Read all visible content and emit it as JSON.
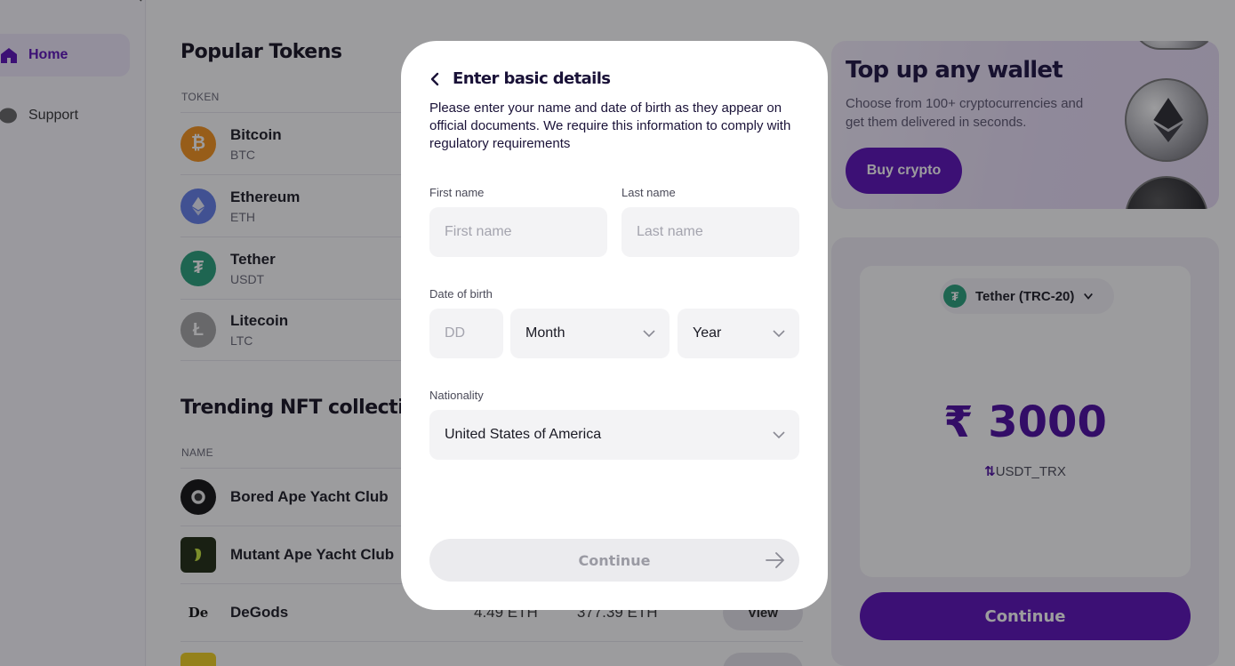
{
  "sidebar": {
    "items": [
      {
        "label": "Home",
        "icon": "home-icon",
        "active": true
      },
      {
        "label": "Support",
        "icon": "chat-icon",
        "active": false
      }
    ]
  },
  "tokens": {
    "title": "Popular Tokens",
    "col_token": "TOKEN",
    "rows": [
      {
        "name": "Bitcoin",
        "ticker": "BTC",
        "icon": "bitcoin-icon",
        "color": "#f7931a"
      },
      {
        "name": "Ethereum",
        "ticker": "ETH",
        "icon": "ethereum-icon",
        "color": "#627eea"
      },
      {
        "name": "Tether",
        "ticker": "USDT",
        "icon": "tether-icon",
        "color": "#26a17b"
      },
      {
        "name": "Litecoin",
        "ticker": "LTC",
        "icon": "litecoin-icon",
        "color": "#a5a5a5"
      }
    ]
  },
  "nfts": {
    "title": "Trending NFT collections",
    "col_name": "NAME",
    "rows": [
      {
        "name": "Bored Ape Yacht Club",
        "floor": "",
        "volume": "",
        "view": ""
      },
      {
        "name": "Mutant Ape Yacht Club",
        "floor": "",
        "volume": "",
        "view": ""
      },
      {
        "name": "DeGods",
        "floor": "4.49 ETH",
        "volume": "377.39 ETH",
        "view": "View"
      }
    ]
  },
  "promo": {
    "title": "Top up any wallet",
    "text": "Choose from 100+ cryptocurrencies and get them delivered in seconds.",
    "button": "Buy crypto"
  },
  "widget": {
    "asset": "Tether (TRC-20)",
    "amount": "₹ 3000",
    "currency": "USDT_TRX",
    "button": "Continue"
  },
  "modal": {
    "title": "Enter basic details",
    "description": "Please enter your name and date of birth as they appear on official documents. We require this information to comply with regulatory requirements",
    "first_name": {
      "label": "First name",
      "placeholder": "First name",
      "value": ""
    },
    "last_name": {
      "label": "Last name",
      "placeholder": "Last name",
      "value": ""
    },
    "dob": {
      "label": "Date of birth",
      "day_placeholder": "DD",
      "month": "Month",
      "year": "Year"
    },
    "nationality": {
      "label": "Nationality",
      "value": "United States of America"
    },
    "continue": "Continue"
  },
  "colors": {
    "brand": "#5b0fb8",
    "overlay": "rgba(20,20,24,0.42)"
  }
}
